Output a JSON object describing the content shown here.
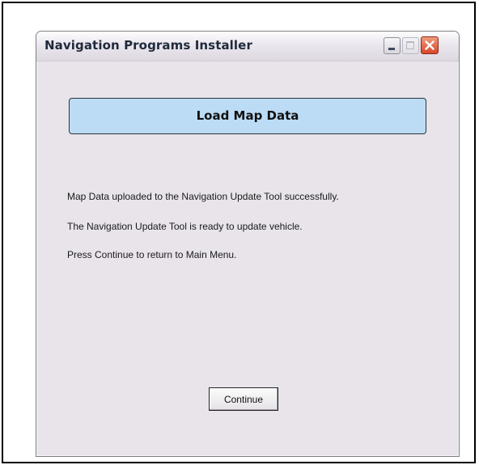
{
  "window": {
    "title": "Navigation Programs Installer"
  },
  "titlebar_buttons": {
    "minimize_icon": "minimize-icon",
    "maximize_icon": "maximize-icon",
    "close_icon": "close-icon"
  },
  "header": {
    "title": "Load Map Data"
  },
  "messages": [
    "Map Data uploaded to the Navigation Update Tool successfully.",
    "The Navigation Update Tool is ready to update vehicle.",
    "Press Continue to return to Main Menu."
  ],
  "actions": {
    "continue_label": "Continue"
  },
  "colors": {
    "header_fill": "#bcdcf6",
    "window_background": "#e8e4ea",
    "close_button": "#d8482a"
  }
}
